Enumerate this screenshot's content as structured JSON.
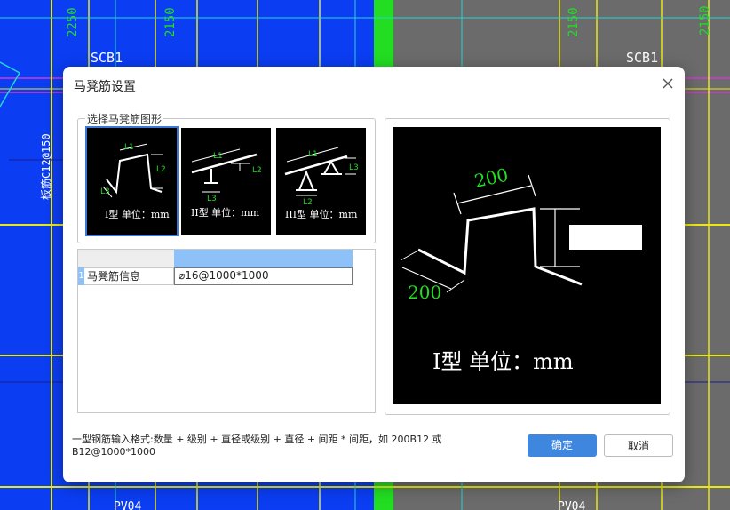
{
  "background": {
    "labels": {
      "scb1_left": "SCB1",
      "scb1_right": "SCB1",
      "dim_a": "2250",
      "dim_b": "2150",
      "dim_c": "2150",
      "dim_d": "2150",
      "rebar_note": "板筋C12@150",
      "pv_left": "PV04",
      "pv_right": "PV04"
    },
    "colors": {
      "blue": "#0b3df2",
      "grey": "#6b6b6b",
      "green": "#22dd22",
      "yellow": "#e8e817",
      "magenta": "#d23ad2",
      "cyan": "#22d6d6"
    }
  },
  "dialog": {
    "title": "马凳筋设置",
    "close_icon": "close-icon",
    "group_label": "选择马凳筋图形",
    "shapes": [
      {
        "caption": "I型 单位：mm",
        "l1": "L1",
        "l2": "L2",
        "l3": "L3",
        "selected": true
      },
      {
        "caption": "II型 单位：mm",
        "l1": "L1",
        "l2": "L2",
        "l3": "L3",
        "selected": false
      },
      {
        "caption": "III型 单位：mm",
        "l1": "L1",
        "l2": "L2",
        "l3": "L3",
        "selected": false
      }
    ],
    "grid": {
      "row_number": "1",
      "name": "马凳筋信息",
      "value": "⌀16@1000*1000"
    },
    "preview": {
      "dim_top": "200",
      "dim_left": "200",
      "caption": "I型 单位：mm"
    },
    "hint": "一型钢筋输入格式:数量 + 级别 + 直径或级别 + 直径 + 间距 * 间距，如 200B12 或 B12@1000*1000",
    "ok_label": "确定",
    "cancel_label": "取消",
    "accent": "#3f86de"
  }
}
